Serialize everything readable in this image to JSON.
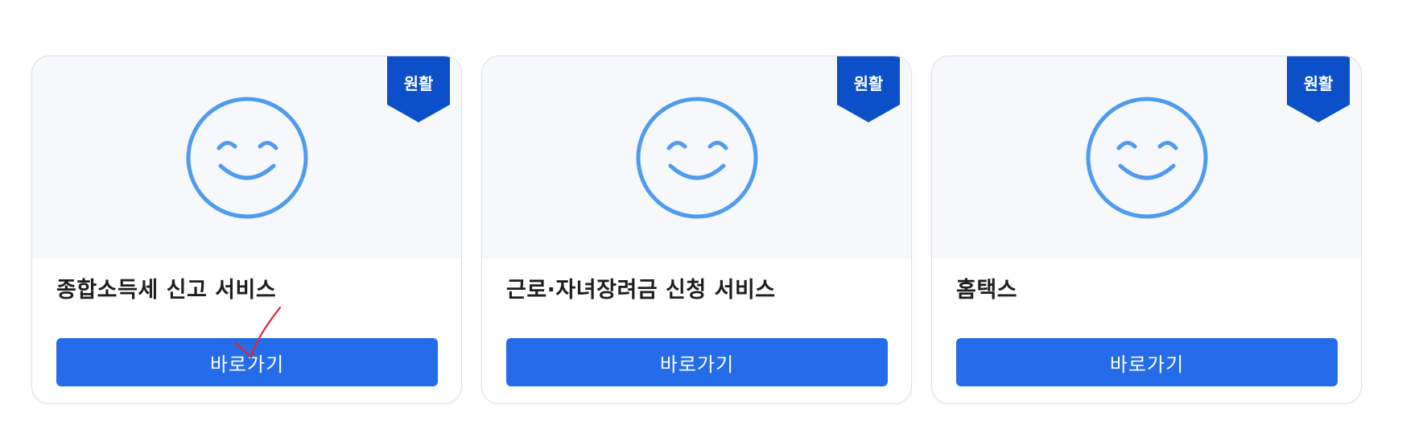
{
  "cards": [
    {
      "title": "종합소득세 신고 서비스",
      "status": "원활",
      "button_label": "바로가기"
    },
    {
      "title": "근로·자녀장려금 신청 서비스",
      "status": "원활",
      "button_label": "바로가기"
    },
    {
      "title": "홈택스",
      "status": "원활",
      "button_label": "바로가기"
    }
  ],
  "colors": {
    "button": "#256cea",
    "ribbon": "#0b50c8",
    "smiley": "#4e9bef",
    "visual_bg": "#f6f8fc"
  }
}
